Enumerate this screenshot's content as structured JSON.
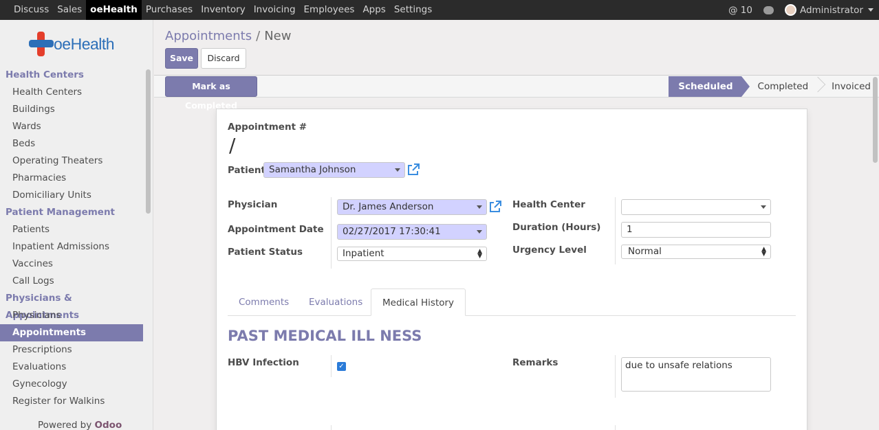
{
  "topbar": {
    "menu": [
      "Discuss",
      "Sales",
      "oeHealth",
      "Purchases",
      "Inventory",
      "Invoicing",
      "Employees",
      "Apps",
      "Settings"
    ],
    "active_index": 2,
    "mentions": "@ 10",
    "user": "Administrator"
  },
  "sidebar": {
    "logo_text": "oeHealth",
    "sections": [
      {
        "title": "Health Centers",
        "items": [
          "Health Centers",
          "Buildings",
          "Wards",
          "Beds",
          "Operating Theaters",
          "Pharmacies",
          "Domiciliary Units"
        ]
      },
      {
        "title": "Patient Management",
        "items": [
          "Patients",
          "Inpatient Admissions",
          "Vaccines",
          "Call Logs"
        ]
      },
      {
        "title": "Physicians & Appointments",
        "items": [
          "Physicians",
          "Appointments",
          "Prescriptions",
          "Evaluations",
          "Gynecology",
          "Register for Walkins"
        ]
      }
    ],
    "active_item": "Appointments",
    "powered_prefix": "Powered by",
    "powered_brand": "Odoo"
  },
  "control": {
    "breadcrumb_parent": "Appointments",
    "breadcrumb_sep": "/",
    "breadcrumb_current": "New",
    "save_label": "Save",
    "discard_label": "Discard"
  },
  "statusbar": {
    "action_label": "Mark as Completed",
    "stages": [
      "Scheduled",
      "Completed",
      "Invoiced"
    ],
    "active_stage": "Scheduled"
  },
  "form": {
    "appointment_label": "Appointment #",
    "appointment_value": "/",
    "patient_label": "Patient",
    "patient_value": "Samantha Johnson",
    "physician_label": "Physician",
    "physician_value": "Dr. James Anderson",
    "date_label": "Appointment Date",
    "date_value": "02/27/2017 17:30:41",
    "patient_status_label": "Patient Status",
    "patient_status_value": "Inpatient",
    "health_center_label": "Health Center",
    "health_center_value": "",
    "duration_label": "Duration (Hours)",
    "duration_value": "1",
    "urgency_label": "Urgency Level",
    "urgency_value": "Normal",
    "tabs": [
      "Comments",
      "Evaluations",
      "Medical History"
    ],
    "active_tab": "Medical History",
    "section_title": "PAST MEDICAL ILL NESS",
    "hbv_label": "HBV Infection",
    "hbv_checked": true,
    "remarks_label": "Remarks",
    "remarks_value": "due to unsafe relations"
  },
  "colors": {
    "accent": "#7c7bad",
    "topbar": "#2b2b2b",
    "required_field": "#d2d2ff",
    "checkbox": "#2a7bd8"
  }
}
